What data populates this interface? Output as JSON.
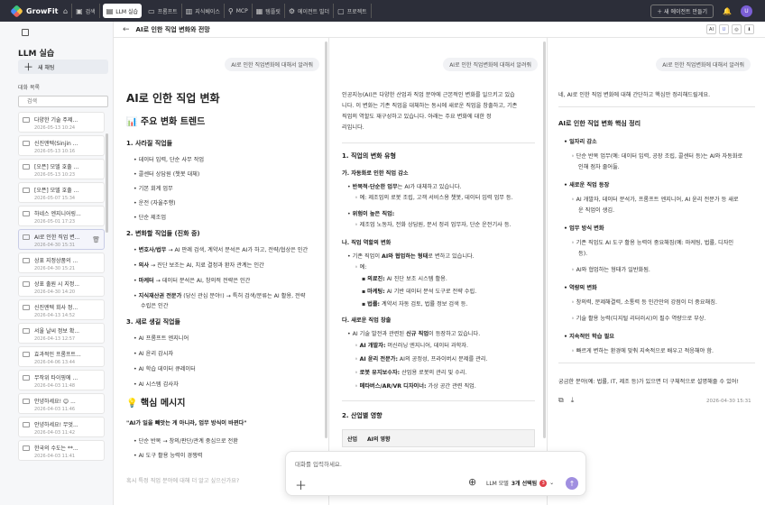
{
  "app": {
    "name": "GrowFit"
  },
  "nav": [
    {
      "label": "",
      "icon": "home-icon"
    },
    {
      "label": "검색",
      "icon": "search-icon"
    },
    {
      "label": "LLM 실습",
      "icon": "chat-icon"
    },
    {
      "label": "프롬프트",
      "icon": "terminal-icon"
    },
    {
      "label": "지식베이스",
      "icon": "book-icon"
    },
    {
      "label": "MCP",
      "icon": "plug-icon"
    },
    {
      "label": "템플릿",
      "icon": "template-icon"
    },
    {
      "label": "에이전트 빌더",
      "icon": "agent-icon"
    },
    {
      "label": "프로젝트",
      "icon": "folder-icon"
    }
  ],
  "topright": {
    "create_label": "새 에이전트 만들기",
    "avatar": "U"
  },
  "sidebar": {
    "title": "LLM 실습",
    "new_chat": "새 채팅",
    "section": "대화 목록",
    "search_placeholder": "검색",
    "items": [
      {
        "title": "다양한 기술 주제...",
        "date": "2026-05-13 10:24"
      },
      {
        "title": "신진앤텍(Sinjin ...",
        "date": "2026-05-13 10:16"
      },
      {
        "title": "[오픈] 모델 호출 ...",
        "date": "2026-05-13 10:23"
      },
      {
        "title": "[오픈] 모델 호출 ...",
        "date": "2026-05-07 15:34"
      },
      {
        "title": "하네스 엔지니어링...",
        "date": "2026-05-01 17:23"
      },
      {
        "title": "AI로 인한 직업 변...",
        "date": "2026-04-30 15:31"
      },
      {
        "title": "상표 지정상품의 ...",
        "date": "2026-04-30 15:21"
      },
      {
        "title": "상표 출원 시 지정...",
        "date": "2026-04-30 14:20"
      },
      {
        "title": "신진엔텍 회사 정...",
        "date": "2026-04-13 14:52"
      },
      {
        "title": "서울 날씨 정보 확...",
        "date": "2026-04-13 12:57"
      },
      {
        "title": "효과적인 프롬프트...",
        "date": "2026-04-06 13:44"
      },
      {
        "title": "무작위 타이핑에 ...",
        "date": "2026-04-03 11:48"
      },
      {
        "title": "안녕하세요! 😊 ...",
        "date": "2026-04-03 11:46"
      },
      {
        "title": "안녕하세요! 무엇...",
        "date": "2026-04-03 11:42"
      },
      {
        "title": "한국의 수도는 **...",
        "date": "2026-04-03 11:41"
      }
    ]
  },
  "header": {
    "title": "AI로 인한 직업 변화와 전망",
    "icons": [
      "AI",
      "U",
      "◎",
      "⬇"
    ]
  },
  "user_prompt": "AI로 인한 직업변화에 대해서 알려줘",
  "panel1": {
    "h1": "AI로 인한 직업 변화",
    "h2a": "📊 주요 변화 트렌드",
    "s1": "1. 사라질 직업들",
    "s1_items": [
      "데이터 입력, 단순 사무 작업",
      "콜센터 상담원 (챗봇 대체)",
      "기본 회계 업무",
      "운전 (자율주행)",
      "단순 제조업"
    ],
    "s2": "2. 변화할 직업들 (진화 중)",
    "s2_items": [
      {
        "b": "변호사/법무",
        "t": " → AI 판례 검색, 계약서 분석은 AI가 하고, 전략/협상은 인간"
      },
      {
        "b": "의사",
        "t": " → 진단 보조는 AI, 치료 결정과 환자 관계는 인간"
      },
      {
        "b": "마케터",
        "t": " → 데이터 분석은 AI, 창의적 전략은 인간"
      },
      {
        "b": "지식재산권 전문가",
        "t": " (당신 관심 분야!) → 특허 검색/분류는 AI 활용, 전략"
      }
    ],
    "s2_cont": "수립은 인간",
    "s3": "3. 새로 생길 직업들",
    "s3_items": [
      "AI 프롬프트 엔지니어",
      "AI 윤리 감시자",
      "AI 학습 데이터 큐레이터",
      "AI 시스템 감사자"
    ],
    "h2b": "💡 핵심 메시지",
    "quote": "\"AI가 일을 빼앗는 게 아니라, 업무 방식이 바뀐다\"",
    "m_items": [
      "단순 반복 → 창의/판단/관계 중심으로 전환",
      "AI 도구 활용 능력이 경쟁력"
    ],
    "faded": "혹시 특정 직업 분야에 대해 더 알고 싶으신가요?"
  },
  "panel2": {
    "intro": [
      "인공지능(AI)은 다양한 산업과 직업 분야에 근본적인 변화를 일으키고 있습",
      "니다. 이 변화는 기존 직업을 대체하는 동시에 새로운 직업을 창출하고, 기존",
      "직업의 역할도 재구성하고 있습니다. 아래는 주요 변화에 대한 정",
      "리입니다."
    ],
    "h1": "1. 직업의 변화 유형",
    "ga": "가. 자동화로 인한 직업 감소",
    "ga1_b": "반복적·단순한 업무",
    "ga1_t": "는 AI가 대체하고 있습니다.",
    "ga1_sub": "예: 제조업의 로봇 조립, 고객 서비스용 챗봇, 데이터 입력 업무 등.",
    "ga2_b": "위험이 높은 직업:",
    "ga2_sub": "제조업 노동자, 전화 상담원, 문서 정리 업무자, 단순 운전기사 등.",
    "na": "나. 직업 역할의 변화",
    "na1_t": "기존 직업이 ",
    "na1_b": "AI와 협업하는 형태",
    "na1_t2": "로 변하고 있습니다.",
    "na_ex": "예:",
    "na_ex_items": [
      {
        "b": "의료진:",
        "t": " AI 진단 보조 시스템 활용."
      },
      {
        "b": "마케팅:",
        "t": " AI 기반 데이터 분석 도구로 전략 수립."
      },
      {
        "b": "법률:",
        "t": " 계약서 자동 검토, 법률 정보 검색 등."
      }
    ],
    "da": "다. 새로운 직업 창출",
    "da1_t": "AI 기술 발전과 관련된 ",
    "da1_b": "신규 직업",
    "da1_t2": "이 등장하고 있습니다.",
    "da_items": [
      {
        "b": "AI 개발자:",
        "t": " 머신러닝 엔지니어, 데이터 과학자."
      },
      {
        "b": "AI 윤리 전문가:",
        "t": " AI의 공정성, 프라이버시 문제를 관리."
      },
      {
        "b": "로봇 유지보수자:",
        "t": " 산업용 로봇의 관리 및 수리."
      },
      {
        "b": "메타버스/AR/VR 디자이너:",
        "t": " 가상 공간 관련 직업."
      }
    ],
    "h2": "2. 산업별 영향",
    "table_headers": [
      "산업",
      "AI의 영향"
    ]
  },
  "panel3": {
    "intro": "네, AI로 인한 직업 변화에 대해 간단하고 핵심만 정리해드릴게요.",
    "h": "AI로 인한 직업 변화 핵심 정리",
    "groups": [
      {
        "title": "일자리 감소",
        "lines": [
          "단순 반복 업무(예: 데이터 입력, 공장 조립, 콜센터 등)는 AI와 자동화로",
          "인해 점차 줄어듦."
        ]
      },
      {
        "title": "새로운 직업 등장",
        "lines": [
          "AI 개발자, 데이터 분석가, 프롬프트 엔지니어, AI 윤리 전문가 등 새로",
          "운 직업이 생김."
        ]
      },
      {
        "title": "업무 방식 변화",
        "lines": [
          "기존 직업도 AI 도구 활용 능력이 중요해짐(예: 마케팅, 법률, 디자인",
          "등).",
          "AI와 협업하는 형태가 일반화됨."
        ]
      },
      {
        "title": "역량의 변화",
        "lines": [
          "창의력, 문제해결력, 소통력 등 인간만의 강점이 더 중요해짐.",
          "기술 활용 능력(디지털 리터러시)이 필수 역량으로 부상."
        ]
      },
      {
        "title": "지속적인 학습 필요",
        "lines": [
          "빠르게 변하는 환경에 맞춰 지속적으로 배우고 적응해야 함."
        ]
      }
    ],
    "closing": "궁금한 분야(예: 법률, IT, 제조 등)가 있으면 더 구체적으로 설명해줄 수 있어!",
    "timestamp": "2026-04-30 15:31"
  },
  "composer": {
    "placeholder": "대화를 입력하세요.",
    "model_label": "LLM 모델",
    "selected": "3개 선택됨",
    "count": "3"
  }
}
